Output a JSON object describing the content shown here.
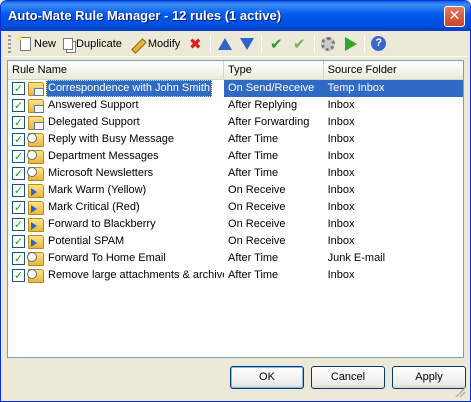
{
  "window": {
    "title": "Auto-Mate Rule Manager - 12 rules (1 active)",
    "close_glyph": "✕"
  },
  "toolbar": {
    "new_label": "New",
    "duplicate_label": "Duplicate",
    "modify_label": "Modify",
    "icons": [
      "new-icon",
      "duplicate-icon",
      "modify-icon",
      "delete-icon",
      "move-up-icon",
      "move-down-icon",
      "enable-icon",
      "disable-icon",
      "settings-icon",
      "run-icon",
      "help-icon"
    ]
  },
  "list": {
    "columns": [
      "Rule Name",
      "Type",
      "Source Folder"
    ],
    "rows": [
      {
        "name": "Correspondence with John Smith",
        "type": "On Send/Receive",
        "folder": "Temp Inbox",
        "checked": true,
        "selected": true,
        "icon": "folder-env"
      },
      {
        "name": "Answered Support",
        "type": "After Replying",
        "folder": "Inbox",
        "checked": true,
        "selected": false,
        "icon": "folder-env"
      },
      {
        "name": "Delegated Support",
        "type": "After Forwarding",
        "folder": "Inbox",
        "checked": true,
        "selected": false,
        "icon": "folder-env"
      },
      {
        "name": "Reply with Busy Message",
        "type": "After Time",
        "folder": "Inbox",
        "checked": true,
        "selected": false,
        "icon": "folder-clock"
      },
      {
        "name": "Department Messages",
        "type": "After Time",
        "folder": "Inbox",
        "checked": true,
        "selected": false,
        "icon": "folder-clock"
      },
      {
        "name": "Microsoft Newsletters",
        "type": "After Time",
        "folder": "Inbox",
        "checked": true,
        "selected": false,
        "icon": "folder-clock"
      },
      {
        "name": "Mark Warm (Yellow)",
        "type": "On Receive",
        "folder": "Inbox",
        "checked": true,
        "selected": false,
        "icon": "folder-arrow"
      },
      {
        "name": "Mark Critical (Red)",
        "type": "On Receive",
        "folder": "Inbox",
        "checked": true,
        "selected": false,
        "icon": "folder-arrow"
      },
      {
        "name": "Forward to Blackberry",
        "type": "On Receive",
        "folder": "Inbox",
        "checked": true,
        "selected": false,
        "icon": "folder-arrow"
      },
      {
        "name": "Potential SPAM",
        "type": "On Receive",
        "folder": "Inbox",
        "checked": true,
        "selected": false,
        "icon": "folder-arrow"
      },
      {
        "name": "Forward To Home Email",
        "type": "After Time",
        "folder": "Junk E-mail",
        "checked": true,
        "selected": false,
        "icon": "folder-clock"
      },
      {
        "name": "Remove large attachments & archive",
        "type": "After Time",
        "folder": "Inbox",
        "checked": true,
        "selected": false,
        "icon": "folder-clock"
      }
    ]
  },
  "buttons": {
    "ok": "OK",
    "cancel": "Cancel",
    "apply": "Apply"
  },
  "colors": {
    "titlebar": "#0054E3",
    "selection": "#316AC5",
    "check": "#21A121"
  }
}
